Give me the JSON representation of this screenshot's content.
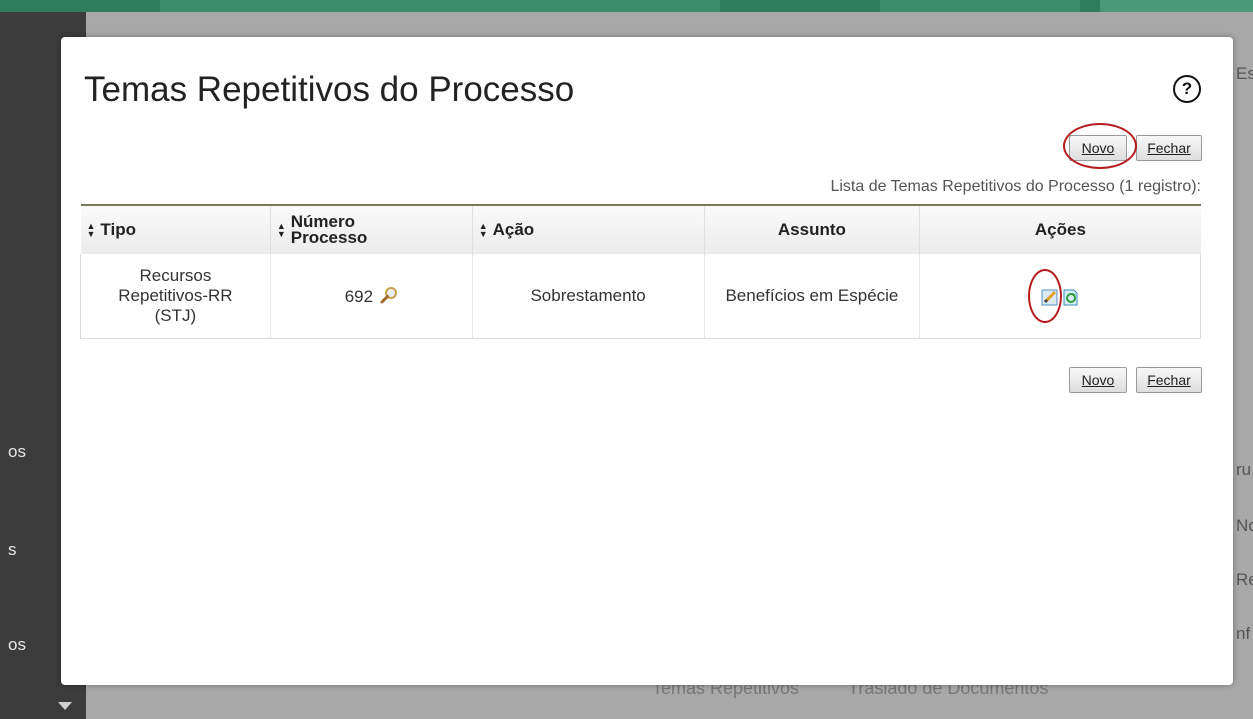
{
  "background": {
    "sidebar_fragments": [
      "os",
      "s",
      "os"
    ],
    "right_fragments": [
      "Es",
      "ru",
      "No",
      "Re",
      "nf"
    ],
    "bottom_tabs": [
      "Temas Repetitivos",
      "Traslado de Documentos"
    ]
  },
  "modal": {
    "title": "Temas Repetitivos do Processo",
    "help_symbol": "?",
    "novo_label": "Novo",
    "fechar_label": "Fechar",
    "list_caption": "Lista de Temas Repetitivos do Processo (1 registro):",
    "table": {
      "headers": {
        "tipo": "Tipo",
        "numero_line1": "Número",
        "numero_line2": "Processo",
        "acao": "Ação",
        "assunto": "Assunto",
        "acoes": "Ações"
      },
      "rows": [
        {
          "tipo_line1": "Recursos",
          "tipo_line2": "Repetitivos-RR",
          "tipo_line3": "(STJ)",
          "numero": "692",
          "acao": "Sobrestamento",
          "assunto": "Benefícios em Espécie"
        }
      ]
    }
  },
  "icons": {
    "sort": "sort-arrows-icon",
    "search": "magnifier-icon",
    "edit": "edit-pencil-icon",
    "other_action": "document-refresh-icon",
    "help": "question-circle-icon"
  },
  "colors": {
    "highlight_circle": "#b51c1c",
    "header_top_rule": "#7a7a58"
  }
}
